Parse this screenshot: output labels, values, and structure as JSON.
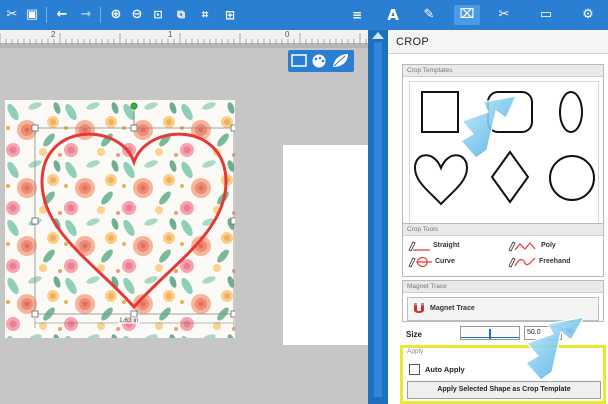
{
  "toolbar": {
    "icons": [
      "cut-icon",
      "paste-icon",
      "undo-icon",
      "redo-icon",
      "zoom-in-icon",
      "zoom-out-icon",
      "zoom-fit-icon",
      "zoom-page-icon",
      "zoom-selection-icon",
      "grid-icon",
      "menu-icon",
      "text-icon",
      "pen-icon",
      "crop-icon",
      "knife-icon",
      "send-icon",
      "settings-icon"
    ],
    "text_tool_label": "A"
  },
  "ruler": {
    "labels": [
      "2",
      "1",
      "0"
    ]
  },
  "canvas": {
    "measurement_label": "1.63 in"
  },
  "panel": {
    "title": "CROP",
    "templates_label": "Crop Templates",
    "templates": [
      "square",
      "rounded-square",
      "oval",
      "heart",
      "diamond",
      "circle"
    ],
    "tools_label": "Crop Tools",
    "tools": [
      "Straight",
      "Poly",
      "Curve",
      "Freehand"
    ],
    "magnet_section_label": "Magnet Trace",
    "magnet_button_label": "Magnet Trace",
    "size_label": "Size",
    "size_value": "50.0",
    "size_unit": "%",
    "apply_label": "Apply",
    "auto_apply_label": "Auto Apply",
    "apply_button_label": "Apply Selected Shape as Crop Template"
  },
  "colors": {
    "accent": "#2a7fd2",
    "highlight": "#e8ea2d",
    "heart": "#e53935"
  }
}
